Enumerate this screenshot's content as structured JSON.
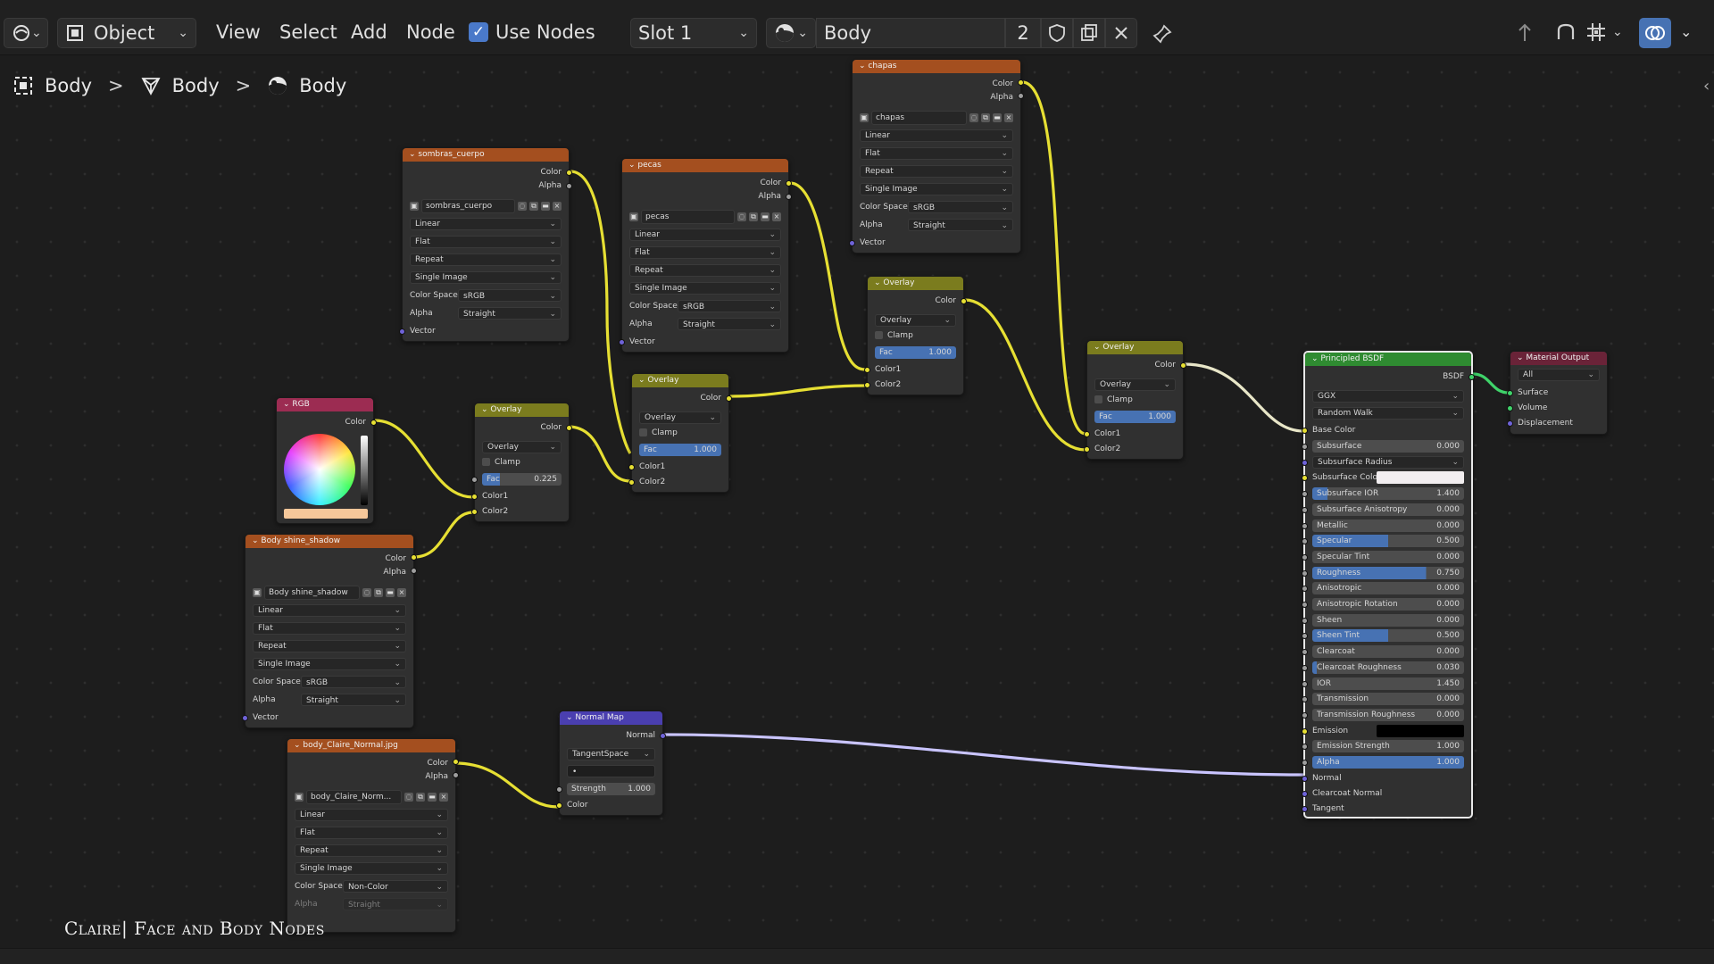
{
  "header": {
    "mode_label": "Object",
    "menus": [
      "View",
      "Select",
      "Add",
      "Node"
    ],
    "use_nodes_label": "Use Nodes",
    "slot_label": "Slot 1",
    "material_name": "Body",
    "user_count": "2"
  },
  "breadcrumb": [
    "Body",
    "Body",
    "Body"
  ],
  "caption": "Claire| Face and Body Nodes",
  "nodes": {
    "sombras": {
      "title": "sombras_cuerpo",
      "out_color": "Color",
      "out_alpha": "Alpha",
      "image": "sombras_cuerpo",
      "interp": "Linear",
      "proj": "Flat",
      "ext": "Repeat",
      "src": "Single Image",
      "cs_label": "Color Space",
      "cs_value": "sRGB",
      "alpha_label": "Alpha",
      "alpha_value": "Straight",
      "vector": "Vector"
    },
    "pecas": {
      "title": "pecas",
      "out_color": "Color",
      "out_alpha": "Alpha",
      "image": "pecas",
      "interp": "Linear",
      "proj": "Flat",
      "ext": "Repeat",
      "src": "Single Image",
      "cs_label": "Color Space",
      "cs_value": "sRGB",
      "alpha_label": "Alpha",
      "alpha_value": "Straight",
      "vector": "Vector"
    },
    "chapas": {
      "title": "chapas",
      "out_color": "Color",
      "out_alpha": "Alpha",
      "image": "chapas",
      "interp": "Linear",
      "proj": "Flat",
      "ext": "Repeat",
      "src": "Single Image",
      "cs_label": "Color Space",
      "cs_value": "sRGB",
      "alpha_label": "Alpha",
      "alpha_value": "Straight",
      "vector": "Vector"
    },
    "shine": {
      "title": "Body shine_shadow",
      "out_color": "Color",
      "out_alpha": "Alpha",
      "image": "Body shine_shadow",
      "interp": "Linear",
      "proj": "Flat",
      "ext": "Repeat",
      "src": "Single Image",
      "cs_label": "Color Space",
      "cs_value": "sRGB",
      "alpha_label": "Alpha",
      "alpha_value": "Straight",
      "vector": "Vector"
    },
    "normal_tex": {
      "title": "body_Claire_Normal.jpg",
      "out_color": "Color",
      "out_alpha": "Alpha",
      "image": "body_Claire_Norm...",
      "interp": "Linear",
      "proj": "Flat",
      "ext": "Repeat",
      "src": "Single Image",
      "cs_label": "Color Space",
      "cs_value": "Non-Color",
      "alpha_label": "Alpha",
      "alpha_value": "Straight"
    },
    "rgb": {
      "title": "RGB",
      "out_color": "Color",
      "swatch": "#f5c79a"
    },
    "mix1": {
      "title": "Overlay",
      "out": "Color",
      "blend": "Overlay",
      "clamp": "Clamp",
      "fac_label": "Fac",
      "fac": "0.225",
      "fac_fraction": 0.225,
      "c1": "Color1",
      "c2": "Color2"
    },
    "mix2": {
      "title": "Overlay",
      "out": "Color",
      "blend": "Overlay",
      "clamp": "Clamp",
      "fac_label": "Fac",
      "fac": "1.000",
      "c1": "Color1",
      "c2": "Color2"
    },
    "mix3": {
      "title": "Overlay",
      "out": "Color",
      "blend": "Overlay",
      "clamp": "Clamp",
      "fac_label": "Fac",
      "fac": "1.000",
      "c1": "Color1",
      "c2": "Color2"
    },
    "mix4": {
      "title": "Overlay",
      "out": "Color",
      "blend": "Overlay",
      "clamp": "Clamp",
      "fac_label": "Fac",
      "fac": "1.000",
      "c1": "Color1",
      "c2": "Color2"
    },
    "normal_map": {
      "title": "Normal Map",
      "out": "Normal",
      "space": "TangentSpace",
      "uv": "•",
      "strength_label": "Strength",
      "strength": "1.000",
      "in_color": "Color"
    },
    "bsdf": {
      "title": "Principled BSDF",
      "out": "BSDF",
      "distribution": "GGX",
      "sss_method": "Random Walk",
      "base_color": "Base Color",
      "rows": [
        {
          "label": "Subsurface",
          "value": "0.000",
          "fill": 0
        },
        {
          "label": "Subsurface Radius",
          "value": "",
          "fill": 0,
          "dropdown": true
        },
        {
          "label": "Subsurface Colo",
          "value": "",
          "fill": 0,
          "swatch": "#f2eef0"
        },
        {
          "label": "Subsurface IOR",
          "value": "1.400",
          "fill": 0.1
        },
        {
          "label": "Subsurface Anisotropy",
          "value": "0.000",
          "fill": 0
        },
        {
          "label": "Metallic",
          "value": "0.000",
          "fill": 0
        },
        {
          "label": "Specular",
          "value": "0.500",
          "fill": 0.5
        },
        {
          "label": "Specular Tint",
          "value": "0.000",
          "fill": 0
        },
        {
          "label": "Roughness",
          "value": "0.750",
          "fill": 0.75
        },
        {
          "label": "Anisotropic",
          "value": "0.000",
          "fill": 0
        },
        {
          "label": "Anisotropic Rotation",
          "value": "0.000",
          "fill": 0
        },
        {
          "label": "Sheen",
          "value": "0.000",
          "fill": 0
        },
        {
          "label": "Sheen Tint",
          "value": "0.500",
          "fill": 0.5
        },
        {
          "label": "Clearcoat",
          "value": "0.000",
          "fill": 0
        },
        {
          "label": "Clearcoat Roughness",
          "value": "0.030",
          "fill": 0.03
        },
        {
          "label": "IOR",
          "value": "1.450",
          "fill": 0
        },
        {
          "label": "Transmission",
          "value": "0.000",
          "fill": 0
        },
        {
          "label": "Transmission Roughness",
          "value": "0.000",
          "fill": 0
        },
        {
          "label": "Emission",
          "value": "",
          "fill": 0,
          "swatch": "#000000"
        },
        {
          "label": "Emission Strength",
          "value": "1.000",
          "fill": 0
        },
        {
          "label": "Alpha",
          "value": "1.000",
          "fill": 1
        }
      ],
      "normal": "Normal",
      "clearcoat_normal": "Clearcoat Normal",
      "tangent": "Tangent"
    },
    "output": {
      "title": "Material Output",
      "target": "All",
      "surface": "Surface",
      "volume": "Volume",
      "displacement": "Displacement"
    }
  }
}
